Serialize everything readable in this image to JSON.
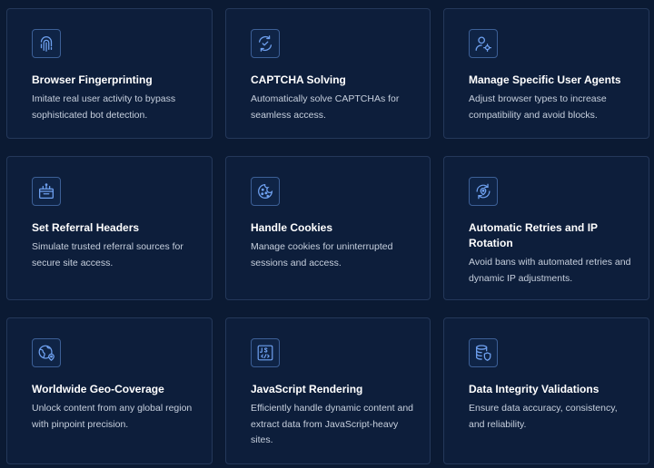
{
  "features": [
    {
      "title": "Browser Fingerprinting",
      "description": "Imitate real user activity to bypass sophisticated bot detection.",
      "icon": "fingerprint-icon"
    },
    {
      "title": "CAPTCHA Solving",
      "description": "Automatically solve CAPTCHAs for seamless access.",
      "icon": "captcha-icon"
    },
    {
      "title": "Manage Specific User Agents",
      "description": "Adjust browser types to increase compatibility and avoid blocks.",
      "icon": "user-gear-icon"
    },
    {
      "title": "Set Referral Headers",
      "description": "Simulate trusted referral sources for secure site access.",
      "icon": "browser-window-icon"
    },
    {
      "title": "Handle Cookies",
      "description": "Manage cookies for uninterrupted sessions and access.",
      "icon": "cookie-icon"
    },
    {
      "title": "Automatic Retries and IP Rotation",
      "description": "Avoid bans with automated retries and dynamic IP adjustments.",
      "icon": "rotation-location-icon"
    },
    {
      "title": "Worldwide Geo-Coverage",
      "description": "Unlock content from any global region with pinpoint precision.",
      "icon": "globe-pin-icon"
    },
    {
      "title": "JavaScript Rendering",
      "description": "Efficiently handle dynamic content and extract data from JavaScript-heavy sites.",
      "icon": "js-code-icon"
    },
    {
      "title": "Data Integrity Validations",
      "description": "Ensure data accuracy, consistency, and reliability.",
      "icon": "database-shield-icon"
    }
  ],
  "colors": {
    "background": "#0b1a33",
    "card": "#0d1e3b",
    "card_border": "#24385a",
    "icon_accent": "#6fa1f0",
    "title_text": "#ffffff",
    "body_text": "#c7d0de"
  }
}
